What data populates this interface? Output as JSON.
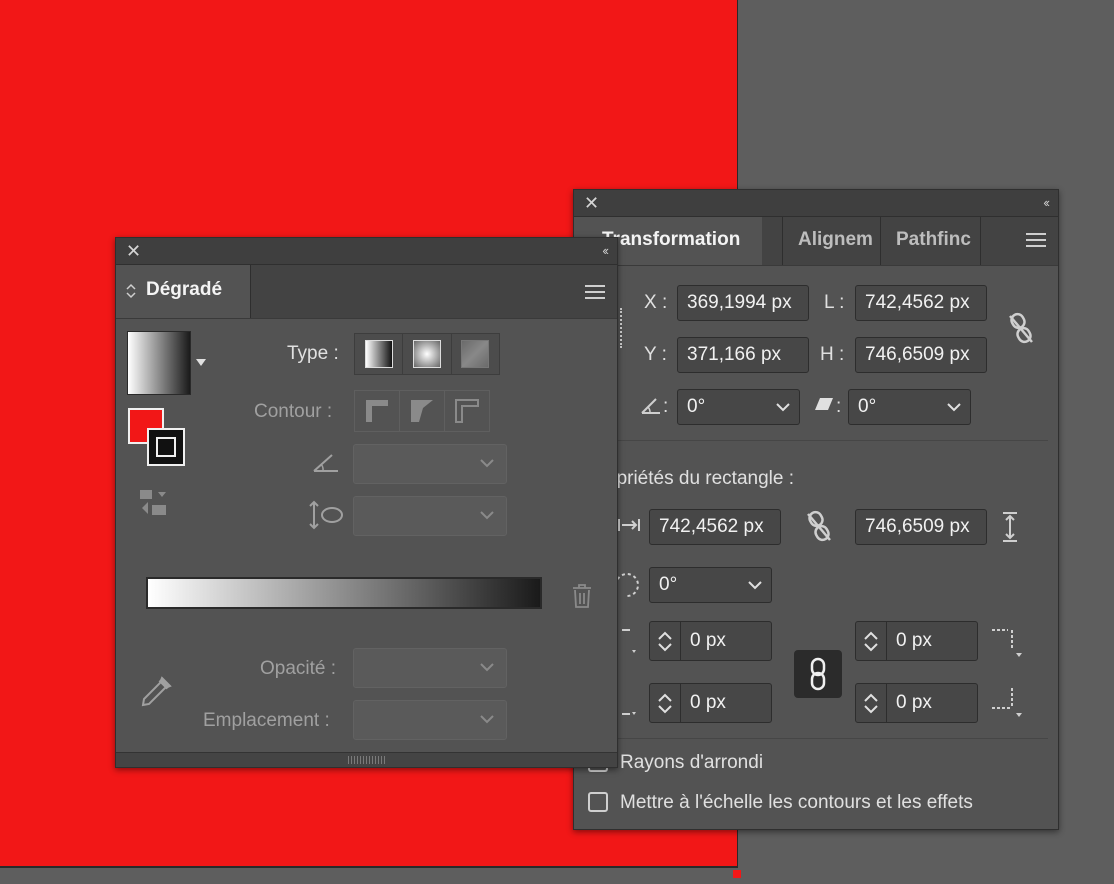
{
  "gradient_panel": {
    "tab_title": "Dégradé",
    "type_label": "Type :",
    "contour_label": "Contour :",
    "opacity_label": "Opacité :",
    "location_label": "Emplacement :"
  },
  "transform_panel": {
    "tabs": [
      "Transformation",
      "Alignem",
      "Pathfinc"
    ],
    "x_label": "X :",
    "x_value": "369,1994 px",
    "y_label": "Y :",
    "y_value": "371,166 px",
    "w_label": "L :",
    "w_value": "742,4562 px",
    "h_label": "H :",
    "h_value": "746,6509 px",
    "angle_value": "0°",
    "shear_value": "0°",
    "rect_props_label": "opriétés du rectangle :",
    "rect_w_value": "742,4562 px",
    "rect_h_value": "746,6509 px",
    "rect_angle_value": "0°",
    "corner_tl": "0 px",
    "corner_tr": "0 px",
    "corner_bl": "0 px",
    "corner_br": "0 px",
    "rounded_corners_label": "Rayons d'arrondi",
    "scale_strokes_label": "Mettre à l'échelle les contours et les effets"
  },
  "colors": {
    "fill": "#f21717",
    "panel_bg": "#535353",
    "canvas_bg": "#5e5e5e"
  }
}
